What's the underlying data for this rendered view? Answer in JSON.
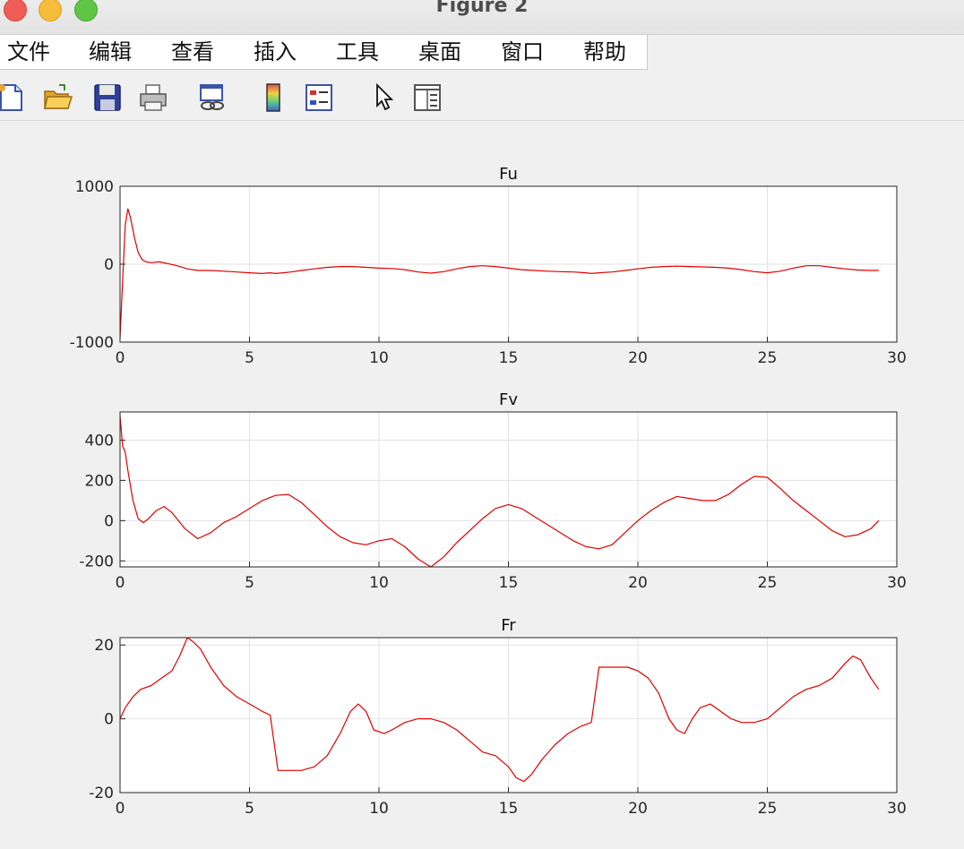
{
  "window": {
    "title": "Figure 2"
  },
  "menu": {
    "items": [
      "文件",
      "编辑",
      "查看",
      "插入",
      "工具",
      "桌面",
      "窗口",
      "帮助"
    ]
  },
  "toolbar": {
    "tools": [
      "new-figure-icon",
      "open-file-icon",
      "save-icon",
      "print-icon",
      "link-plot-icon",
      "insert-colorbar-icon",
      "insert-legend-icon",
      "edit-pointer-icon",
      "property-inspector-icon"
    ]
  },
  "colors": {
    "line": "#e00000",
    "grid": "#e2e2e2",
    "axes": "#262626"
  },
  "chart_data": [
    {
      "type": "line",
      "title": "Fu",
      "xlim": [
        0,
        30
      ],
      "ylim": [
        -1000,
        1000
      ],
      "xticks": [
        "0",
        "5",
        "10",
        "15",
        "20",
        "25",
        "30"
      ],
      "yticks": [
        "-1000",
        "0",
        "1000"
      ],
      "grid": true,
      "x": [
        0,
        0.1,
        0.2,
        0.3,
        0.4,
        0.55,
        0.7,
        0.85,
        1.0,
        1.2,
        1.5,
        1.8,
        2.2,
        2.6,
        3.0,
        3.5,
        4.0,
        4.5,
        5.0,
        5.5,
        5.8,
        6.0,
        6.3,
        6.6,
        7.0,
        7.5,
        8.0,
        8.5,
        9.0,
        9.5,
        10.0,
        10.5,
        11.0,
        11.5,
        12.0,
        12.5,
        13.0,
        13.5,
        14.0,
        14.5,
        15.0,
        15.5,
        16.0,
        16.5,
        17.0,
        17.5,
        18.0,
        18.2,
        18.5,
        19.0,
        19.5,
        20.0,
        20.5,
        21.0,
        21.5,
        22.0,
        22.5,
        23.0,
        23.5,
        24.0,
        24.5,
        25.0,
        25.5,
        26.0,
        26.5,
        27.0,
        27.5,
        28.0,
        28.5,
        29.0,
        29.3
      ],
      "y": [
        -950,
        -200,
        500,
        710,
        600,
        350,
        150,
        60,
        30,
        20,
        30,
        10,
        -20,
        -60,
        -80,
        -80,
        -90,
        -100,
        -110,
        -120,
        -110,
        -120,
        -110,
        -100,
        -80,
        -60,
        -40,
        -30,
        -30,
        -40,
        -50,
        -55,
        -70,
        -100,
        -115,
        -95,
        -60,
        -30,
        -20,
        -30,
        -50,
        -70,
        -80,
        -90,
        -95,
        -100,
        -110,
        -120,
        -110,
        -100,
        -80,
        -60,
        -40,
        -30,
        -25,
        -30,
        -35,
        -40,
        -50,
        -70,
        -95,
        -110,
        -90,
        -50,
        -20,
        -20,
        -40,
        -60,
        -75,
        -80,
        -80
      ]
    },
    {
      "type": "line",
      "title": "Fv",
      "xlim": [
        0,
        30
      ],
      "ylim": [
        -230,
        540
      ],
      "xticks": [
        "0",
        "5",
        "10",
        "15",
        "20",
        "25",
        "30"
      ],
      "yticks": [
        "-200",
        "0",
        "200",
        "400"
      ],
      "grid": true,
      "x": [
        0,
        0.1,
        0.2,
        0.3,
        0.5,
        0.7,
        0.9,
        1.1,
        1.4,
        1.7,
        2.0,
        2.5,
        3.0,
        3.5,
        4.0,
        4.5,
        5.0,
        5.5,
        6.0,
        6.5,
        7.0,
        7.5,
        8.0,
        8.5,
        9.0,
        9.5,
        10.0,
        10.5,
        11.0,
        11.5,
        12.0,
        12.5,
        13.0,
        13.5,
        14.0,
        14.5,
        15.0,
        15.5,
        16.0,
        16.5,
        17.0,
        17.5,
        18.0,
        18.5,
        19.0,
        19.5,
        20.0,
        20.5,
        21.0,
        21.5,
        22.0,
        22.5,
        23.0,
        23.5,
        24.0,
        24.5,
        25.0,
        25.5,
        26.0,
        26.5,
        27.0,
        27.5,
        28.0,
        28.5,
        29.0,
        29.3
      ],
      "y": [
        520,
        370,
        340,
        250,
        100,
        10,
        -10,
        10,
        50,
        70,
        40,
        -40,
        -90,
        -60,
        -10,
        20,
        60,
        100,
        125,
        130,
        90,
        30,
        -30,
        -80,
        -110,
        -120,
        -100,
        -90,
        -130,
        -190,
        -230,
        -180,
        -110,
        -50,
        10,
        60,
        80,
        60,
        20,
        -20,
        -60,
        -100,
        -130,
        -140,
        -120,
        -60,
        0,
        50,
        90,
        120,
        110,
        100,
        100,
        130,
        180,
        220,
        215,
        160,
        100,
        50,
        0,
        -50,
        -80,
        -70,
        -40,
        0
      ]
    },
    {
      "type": "line",
      "title": "Fr",
      "xlim": [
        0,
        30
      ],
      "ylim": [
        -20,
        22
      ],
      "xticks": [
        "0",
        "5",
        "10",
        "15",
        "20",
        "25",
        "30"
      ],
      "yticks": [
        "-20",
        "0",
        "20"
      ],
      "grid": true,
      "x": [
        0,
        0.2,
        0.5,
        0.8,
        1.2,
        1.6,
        2.0,
        2.3,
        2.6,
        2.8,
        3.1,
        3.5,
        4.0,
        4.5,
        5.0,
        5.5,
        5.8,
        6.1,
        6.5,
        7.0,
        7.5,
        8.0,
        8.5,
        8.9,
        9.2,
        9.5,
        9.8,
        10.2,
        10.5,
        11.0,
        11.5,
        12.0,
        12.5,
        13.0,
        13.5,
        14.0,
        14.5,
        15.0,
        15.3,
        15.6,
        15.9,
        16.3,
        16.8,
        17.3,
        17.8,
        18.2,
        18.5,
        18.8,
        19.2,
        19.6,
        20.0,
        20.4,
        20.8,
        21.2,
        21.5,
        21.8,
        22.1,
        22.4,
        22.8,
        23.2,
        23.6,
        24.0,
        24.5,
        25.0,
        25.5,
        26.0,
        26.5,
        27.0,
        27.5,
        28.0,
        28.3,
        28.6,
        29.0,
        29.3
      ],
      "y": [
        0,
        3,
        6,
        8,
        9,
        11,
        13,
        17,
        22,
        21,
        19,
        14,
        9,
        6,
        4,
        2,
        1,
        -14,
        -14,
        -14,
        -13,
        -10,
        -4,
        2,
        4,
        2,
        -3,
        -4,
        -3,
        -1,
        0,
        0,
        -1,
        -3,
        -6,
        -9,
        -10,
        -13,
        -16,
        -17,
        -15,
        -11,
        -7,
        -4,
        -2,
        -1,
        14,
        14,
        14,
        14,
        13,
        11,
        7,
        0,
        -3,
        -4,
        0,
        3,
        4,
        2,
        0,
        -1,
        -1,
        0,
        3,
        6,
        8,
        9,
        11,
        15,
        17,
        16,
        11,
        8
      ]
    }
  ]
}
